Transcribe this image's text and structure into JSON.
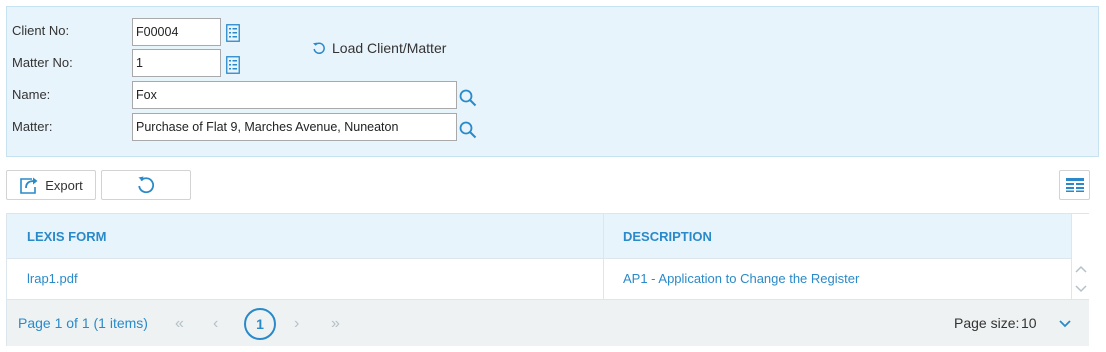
{
  "client_panel": {
    "client_no_label": "Client No:",
    "client_no_value": "F00004",
    "matter_no_label": "Matter No:",
    "matter_no_value": "1",
    "name_label": "Name:",
    "name_value": "Fox",
    "matter_label": "Matter:",
    "matter_value": "Purchase of Flat 9, Marches Avenue, Nuneaton",
    "load_label": "Load Client/Matter"
  },
  "toolbar": {
    "export_label": "Export"
  },
  "grid": {
    "columns": [
      "LEXIS FORM",
      "DESCRIPTION"
    ],
    "rows": [
      {
        "form": "lrap1.pdf",
        "description": "AP1 - Application to Change the Register"
      }
    ]
  },
  "pager": {
    "info": "Page 1 of 1 (1 items)",
    "current_page": "1",
    "page_size_label": "Page size:",
    "page_size_value": "10"
  },
  "colors": {
    "accent": "#2a8ac9",
    "panel_bg": "#e8f4fb",
    "pager_bg": "#eef2f2"
  }
}
